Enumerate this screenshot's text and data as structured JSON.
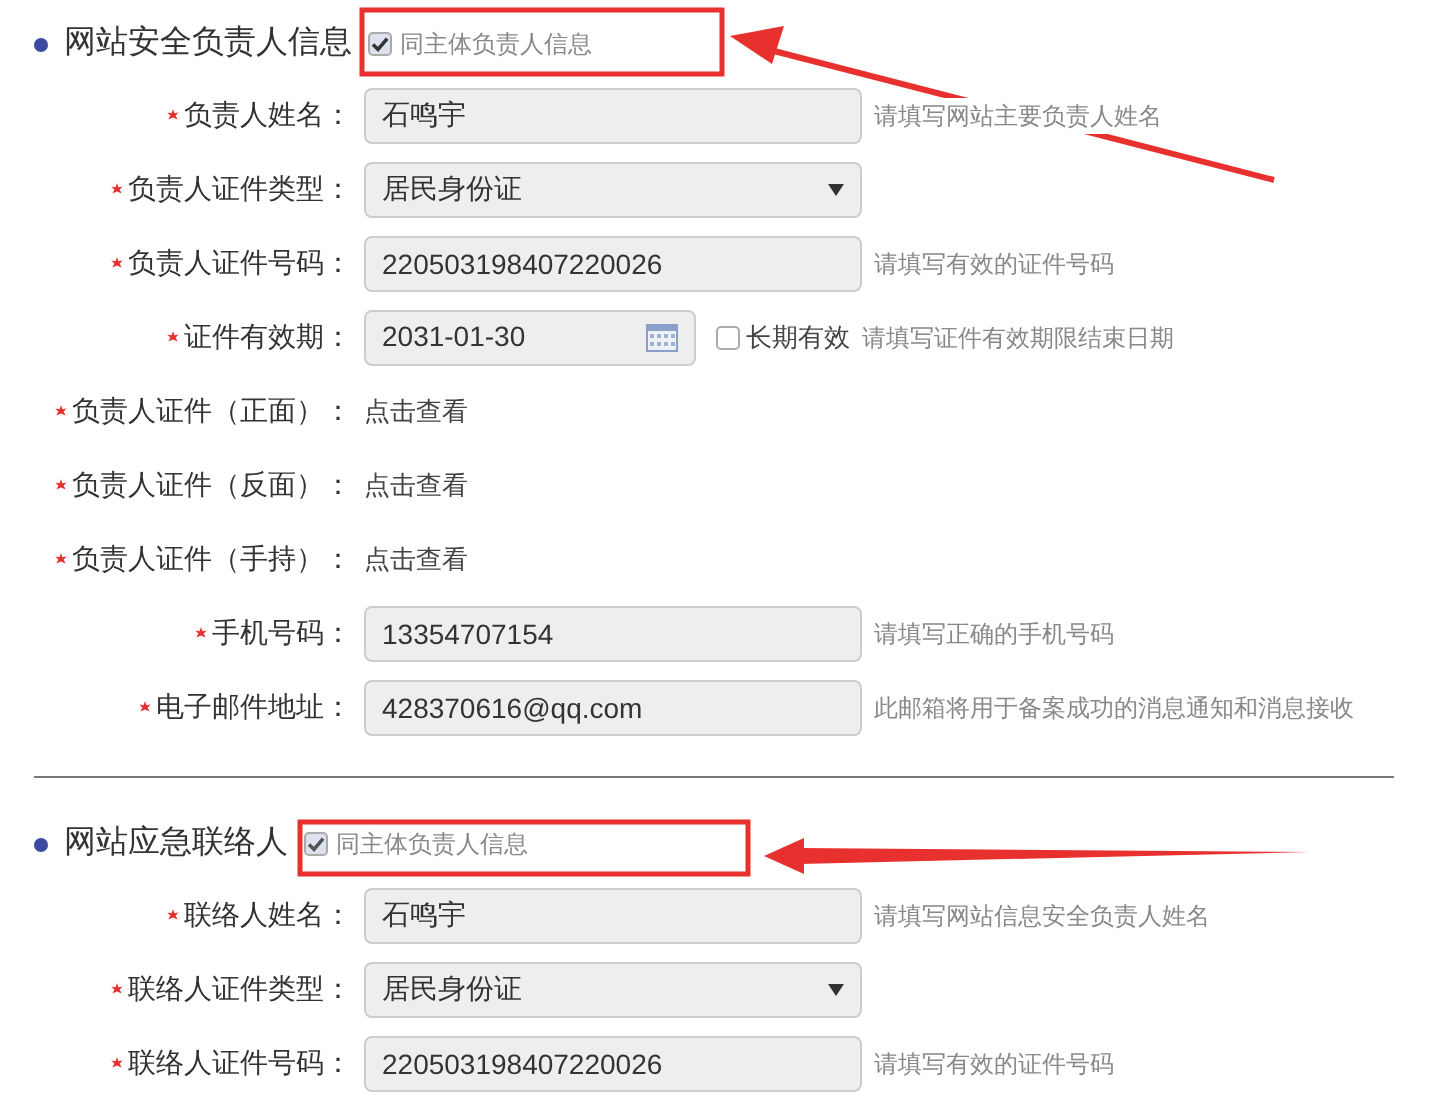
{
  "sections": [
    {
      "heading": "网站安全负责人信息",
      "same_as": {
        "label": "同主体负责人信息",
        "checked": true
      },
      "fields": [
        {
          "kind": "text",
          "label": "负责人姓名：",
          "required": true,
          "value": "石鸣宇",
          "hint": "请填写网站主要负责人姓名"
        },
        {
          "kind": "select",
          "label": "负责人证件类型：",
          "required": true,
          "value": "居民身份证"
        },
        {
          "kind": "text",
          "label": "负责人证件号码：",
          "required": true,
          "value": "220503198407220026",
          "hint": "请填写有效的证件号码"
        },
        {
          "kind": "date",
          "label": "证件有效期：",
          "required": true,
          "value": "2031-01-30",
          "option": {
            "label": "长期有效",
            "checked": false
          },
          "hint": "请填写证件有效期限结束日期"
        },
        {
          "kind": "link",
          "label": "负责人证件（正面）：",
          "required": true,
          "value": "点击查看"
        },
        {
          "kind": "link",
          "label": "负责人证件（反面）：",
          "required": true,
          "value": "点击查看"
        },
        {
          "kind": "link",
          "label": "负责人证件（手持）：",
          "required": true,
          "value": "点击查看"
        },
        {
          "kind": "text",
          "label": "手机号码：",
          "required": true,
          "value": "13354707154",
          "hint": "请填写正确的手机号码"
        },
        {
          "kind": "text",
          "label": "电子邮件地址：",
          "required": true,
          "value": "428370616@qq.com",
          "hint": "此邮箱将用于备案成功的消息通知和消息接收"
        }
      ]
    },
    {
      "heading": "网站应急联络人",
      "same_as": {
        "label": "同主体负责人信息",
        "checked": true
      },
      "fields": [
        {
          "kind": "text",
          "label": "联络人姓名：",
          "required": true,
          "value": "石鸣宇",
          "hint": "请填写网站信息安全负责人姓名"
        },
        {
          "kind": "select",
          "label": "联络人证件类型：",
          "required": true,
          "value": "居民身份证"
        },
        {
          "kind": "text",
          "label": "联络人证件号码：",
          "required": true,
          "value": "220503198407220026",
          "hint": "请填写有效的证件号码"
        }
      ]
    }
  ]
}
